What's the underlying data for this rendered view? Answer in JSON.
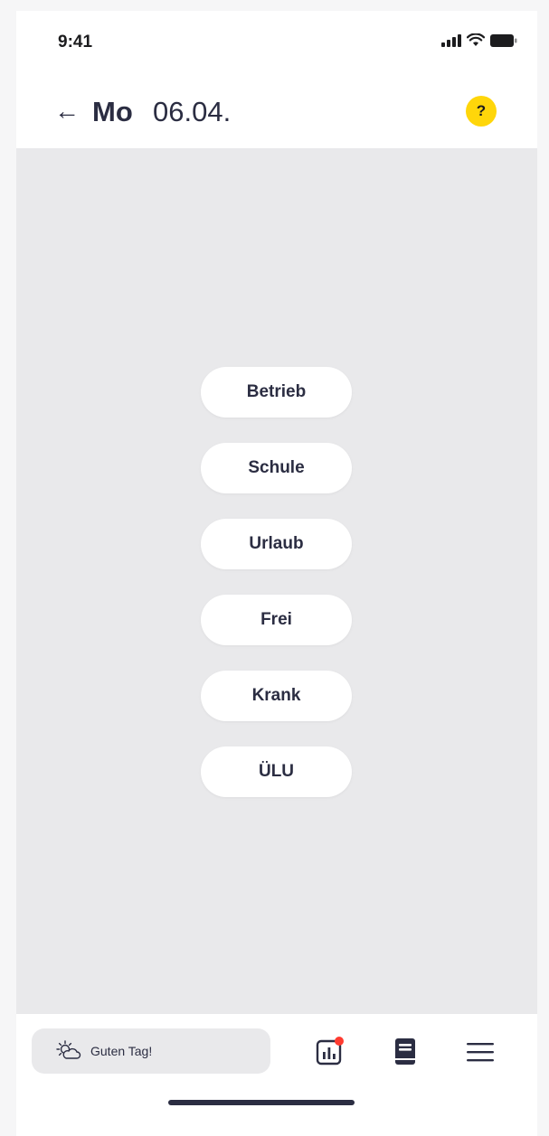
{
  "status_bar": {
    "time": "9:41"
  },
  "header": {
    "back": "←",
    "day": "Mo",
    "date": "06.04.",
    "help": "?"
  },
  "options": [
    "Betrieb",
    "Schule",
    "Urlaub",
    "Frei",
    "Krank",
    "ÜLU"
  ],
  "bottom_bar": {
    "greeting": "Guten Tag!",
    "icons": [
      "weather-icon",
      "stats-icon",
      "book-icon",
      "menu-icon"
    ],
    "notification_color": "#ff3b30"
  },
  "colors": {
    "accent": "#ffd60a",
    "text": "#2b2d42",
    "background": "#e9e9eb"
  }
}
